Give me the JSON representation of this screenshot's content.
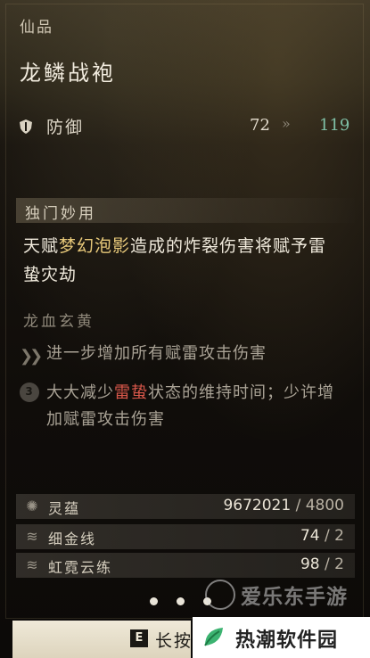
{
  "item": {
    "rarity": "仙品",
    "name": "龙鳞战袍"
  },
  "stat": {
    "icon": "shield-icon",
    "label": "防御",
    "current": "72",
    "arrow": "»",
    "upgraded": "119"
  },
  "unique": {
    "header": "独门妙用",
    "desc_pre": "天赋",
    "desc_hl": "梦幻泡影",
    "desc_post": "造成的炸裂伤害将赋予雷蛰灾劫"
  },
  "set_bonus": {
    "title": "龙血玄黄",
    "effects": [
      {
        "icon": "double-chevron-icon",
        "text": "进一步增加所有赋雷攻击伤害"
      },
      {
        "icon": "circle-3-icon",
        "badge": "3",
        "pre": "大大减少",
        "hl": "雷蛰",
        "post": "状态的维持时间；少许增加赋雷攻击伤害"
      }
    ]
  },
  "materials": [
    {
      "icon": "spirit-essence-icon",
      "name": "灵蕴",
      "have": "9672021",
      "need": "4800"
    },
    {
      "icon": "gold-thread-icon",
      "name": "细金线",
      "have": "74",
      "need": "2"
    },
    {
      "icon": "rainbow-cloud-icon",
      "name": "虹霓云练",
      "have": "98",
      "need": "2"
    }
  ],
  "pager": {
    "count": 3,
    "active": 1
  },
  "action": {
    "key": "E",
    "label": "长按"
  },
  "watermarks": {
    "top": "爱乐东手游",
    "bottom": "热潮软件园"
  },
  "colors": {
    "upgrade": "#7fc0a6",
    "highlight_gold": "#e8c97a",
    "highlight_red": "#d9574a"
  }
}
